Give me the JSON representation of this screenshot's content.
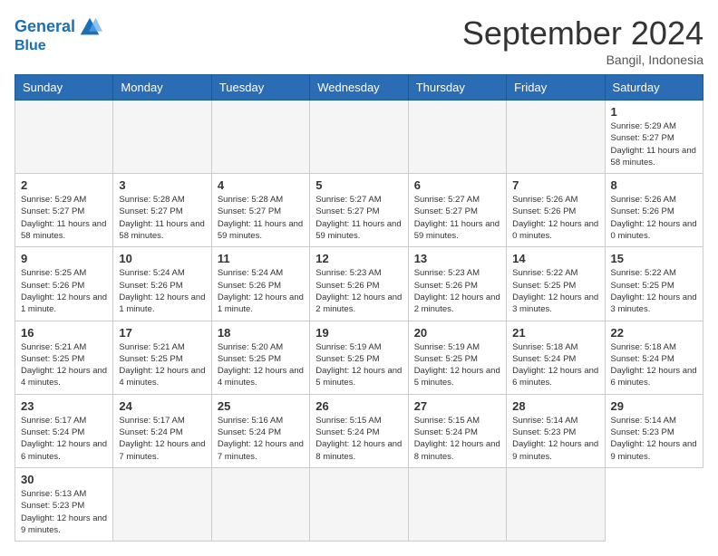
{
  "logo": {
    "line1": "General",
    "line2": "Blue"
  },
  "title": "September 2024",
  "location": "Bangil, Indonesia",
  "weekdays": [
    "Sunday",
    "Monday",
    "Tuesday",
    "Wednesday",
    "Thursday",
    "Friday",
    "Saturday"
  ],
  "days": [
    {
      "num": "",
      "info": ""
    },
    {
      "num": "",
      "info": ""
    },
    {
      "num": "",
      "info": ""
    },
    {
      "num": "",
      "info": ""
    },
    {
      "num": "",
      "info": ""
    },
    {
      "num": "",
      "info": ""
    },
    {
      "num": "1",
      "sunrise": "5:29 AM",
      "sunset": "5:27 PM",
      "daylight": "11 hours and 58 minutes."
    },
    {
      "num": "2",
      "sunrise": "5:29 AM",
      "sunset": "5:27 PM",
      "daylight": "11 hours and 58 minutes."
    },
    {
      "num": "3",
      "sunrise": "5:28 AM",
      "sunset": "5:27 PM",
      "daylight": "11 hours and 58 minutes."
    },
    {
      "num": "4",
      "sunrise": "5:28 AM",
      "sunset": "5:27 PM",
      "daylight": "11 hours and 59 minutes."
    },
    {
      "num": "5",
      "sunrise": "5:27 AM",
      "sunset": "5:27 PM",
      "daylight": "11 hours and 59 minutes."
    },
    {
      "num": "6",
      "sunrise": "5:27 AM",
      "sunset": "5:27 PM",
      "daylight": "11 hours and 59 minutes."
    },
    {
      "num": "7",
      "sunrise": "5:26 AM",
      "sunset": "5:26 PM",
      "daylight": "12 hours and 0 minutes."
    },
    {
      "num": "8",
      "sunrise": "5:26 AM",
      "sunset": "5:26 PM",
      "daylight": "12 hours and 0 minutes."
    },
    {
      "num": "9",
      "sunrise": "5:25 AM",
      "sunset": "5:26 PM",
      "daylight": "12 hours and 1 minute."
    },
    {
      "num": "10",
      "sunrise": "5:24 AM",
      "sunset": "5:26 PM",
      "daylight": "12 hours and 1 minute."
    },
    {
      "num": "11",
      "sunrise": "5:24 AM",
      "sunset": "5:26 PM",
      "daylight": "12 hours and 1 minute."
    },
    {
      "num": "12",
      "sunrise": "5:23 AM",
      "sunset": "5:26 PM",
      "daylight": "12 hours and 2 minutes."
    },
    {
      "num": "13",
      "sunrise": "5:23 AM",
      "sunset": "5:26 PM",
      "daylight": "12 hours and 2 minutes."
    },
    {
      "num": "14",
      "sunrise": "5:22 AM",
      "sunset": "5:25 PM",
      "daylight": "12 hours and 3 minutes."
    },
    {
      "num": "15",
      "sunrise": "5:22 AM",
      "sunset": "5:25 PM",
      "daylight": "12 hours and 3 minutes."
    },
    {
      "num": "16",
      "sunrise": "5:21 AM",
      "sunset": "5:25 PM",
      "daylight": "12 hours and 4 minutes."
    },
    {
      "num": "17",
      "sunrise": "5:21 AM",
      "sunset": "5:25 PM",
      "daylight": "12 hours and 4 minutes."
    },
    {
      "num": "18",
      "sunrise": "5:20 AM",
      "sunset": "5:25 PM",
      "daylight": "12 hours and 4 minutes."
    },
    {
      "num": "19",
      "sunrise": "5:19 AM",
      "sunset": "5:25 PM",
      "daylight": "12 hours and 5 minutes."
    },
    {
      "num": "20",
      "sunrise": "5:19 AM",
      "sunset": "5:25 PM",
      "daylight": "12 hours and 5 minutes."
    },
    {
      "num": "21",
      "sunrise": "5:18 AM",
      "sunset": "5:24 PM",
      "daylight": "12 hours and 6 minutes."
    },
    {
      "num": "22",
      "sunrise": "5:18 AM",
      "sunset": "5:24 PM",
      "daylight": "12 hours and 6 minutes."
    },
    {
      "num": "23",
      "sunrise": "5:17 AM",
      "sunset": "5:24 PM",
      "daylight": "12 hours and 6 minutes."
    },
    {
      "num": "24",
      "sunrise": "5:17 AM",
      "sunset": "5:24 PM",
      "daylight": "12 hours and 7 minutes."
    },
    {
      "num": "25",
      "sunrise": "5:16 AM",
      "sunset": "5:24 PM",
      "daylight": "12 hours and 7 minutes."
    },
    {
      "num": "26",
      "sunrise": "5:15 AM",
      "sunset": "5:24 PM",
      "daylight": "12 hours and 8 minutes."
    },
    {
      "num": "27",
      "sunrise": "5:15 AM",
      "sunset": "5:24 PM",
      "daylight": "12 hours and 8 minutes."
    },
    {
      "num": "28",
      "sunrise": "5:14 AM",
      "sunset": "5:23 PM",
      "daylight": "12 hours and 9 minutes."
    },
    {
      "num": "29",
      "sunrise": "5:14 AM",
      "sunset": "5:23 PM",
      "daylight": "12 hours and 9 minutes."
    },
    {
      "num": "30",
      "sunrise": "5:13 AM",
      "sunset": "5:23 PM",
      "daylight": "12 hours and 9 minutes."
    },
    {
      "num": "",
      "info": ""
    },
    {
      "num": "",
      "info": ""
    },
    {
      "num": "",
      "info": ""
    },
    {
      "num": "",
      "info": ""
    },
    {
      "num": "",
      "info": ""
    }
  ]
}
